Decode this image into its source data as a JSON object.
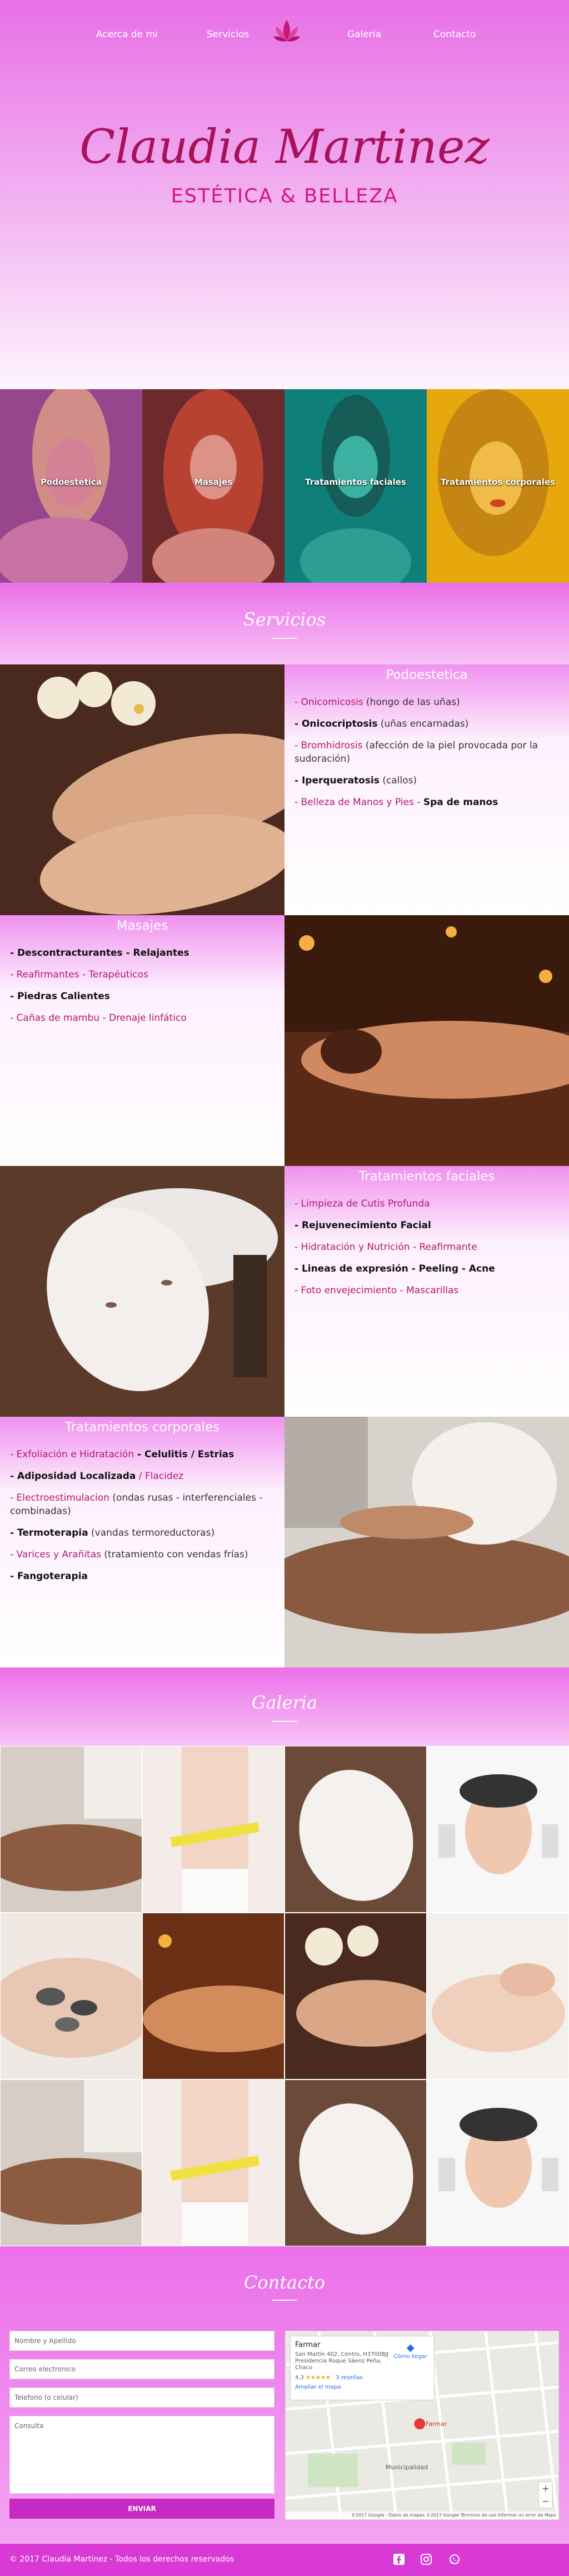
{
  "nav": {
    "about": "Acerca de mi",
    "services": "Servicios",
    "gallery": "Galeria",
    "contact": "Contacto"
  },
  "hero": {
    "title": "Claudia Martinez",
    "subtitle": "ESTÉTICA & BELLEZA"
  },
  "tiles": [
    "Podoestetica",
    "Masajes",
    "Tratamientos faciales",
    "Tratamientos corporales"
  ],
  "services_heading": "Servicios",
  "podo": {
    "title": "Podoestetica",
    "items": [
      [
        [
          "- Onicomicosis",
          "mg"
        ],
        [
          " (hongo de las uñas)",
          ""
        ]
      ],
      [
        [
          "- Onicocriptosis",
          "bk"
        ],
        [
          " (uñas encarnadas)",
          ""
        ]
      ],
      [
        [
          "- Bromhidrosis",
          "mg"
        ],
        [
          " (afección de la piel provocada por la sudoración)",
          ""
        ]
      ],
      [
        [
          "- Iperqueratosis",
          "bk"
        ],
        [
          " (callos)",
          ""
        ]
      ],
      [
        [
          "- Belleza de Manos y Pies",
          "mg"
        ],
        [
          " - ",
          ""
        ],
        [
          "Spa de manos",
          "bk"
        ]
      ]
    ]
  },
  "masajes": {
    "title": "Masajes",
    "items": [
      [
        [
          "- Descontracturantes - Relajantes",
          "bk"
        ]
      ],
      [
        [
          "- Reafirmantes - Terapéuticos",
          "mg"
        ]
      ],
      [
        [
          "- Piedras Calientes",
          "bk"
        ]
      ],
      [
        [
          "- Cañas de mambu - Drenaje linfático",
          "mg"
        ]
      ]
    ]
  },
  "faciales": {
    "title": "Tratamientos faciales",
    "items": [
      [
        [
          "- Limpieza de Cutis Profunda",
          "mg"
        ]
      ],
      [
        [
          "- Rejuvenecimiento Facial",
          "bk"
        ]
      ],
      [
        [
          "- Hidratación y Nutrición - Reafirmante",
          "mg"
        ]
      ],
      [
        [
          "- Lineas de expresión - Peeling - Acne",
          "bk"
        ]
      ],
      [
        [
          "- Foto envejecimiento - Mascarillas",
          "mg"
        ]
      ]
    ]
  },
  "corporales": {
    "title": "Tratamientos corporales",
    "items": [
      [
        [
          "- Exfoliación e Hidratación",
          "mg"
        ],
        [
          " - Celulitis / Estrias",
          "bk"
        ]
      ],
      [
        [
          "- Adiposidad Localizada",
          "bk"
        ],
        [
          " / Flacidez",
          "mg"
        ]
      ],
      [
        [
          "- Electroestimulacion",
          "mg"
        ],
        [
          " (ondas rusas - interferenciales - combinadas)",
          ""
        ]
      ],
      [
        [
          "- Termoterapia",
          "bk"
        ],
        [
          " (vandas termoreductoras)",
          ""
        ]
      ],
      [
        [
          "- Varices y Arañitas",
          "mg"
        ],
        [
          " (tratamiento con vendas frías)",
          ""
        ]
      ],
      [
        [
          "- Fangoterapia",
          "bk"
        ]
      ]
    ]
  },
  "gallery_heading": "Galeria",
  "contact": {
    "heading": "Contacto",
    "name_ph": "Nombre y Apellido",
    "email_ph": "Correo electronico",
    "phone_ph": "Telefono (o celular)",
    "msg_ph": "Consulta",
    "send": "ENVIAR"
  },
  "map": {
    "place": "Farmar",
    "address": "San Martín 402, Centro, H3700BJJ Presidencia Roque Sáenz Peña, Chaco",
    "rating": "4,3",
    "stars": "★★★★★",
    "reviews": "3 reseñas",
    "directions": "Cómo llegar",
    "enlarge": "Ampliar el mapa",
    "pin_label": "Farmar",
    "muni": "Municipalidad",
    "footer": "©2017 Google - Datos de mapas ©2017 Google   Términos de uso   Informar un error de Maps"
  },
  "footer": {
    "copyright": "© 2017 Claudia Martinez - Todos los derechos reservados"
  },
  "colors": {
    "accent": "#d93ad6",
    "brand": "#a8125a",
    "magenta_text": "#b3176f"
  }
}
